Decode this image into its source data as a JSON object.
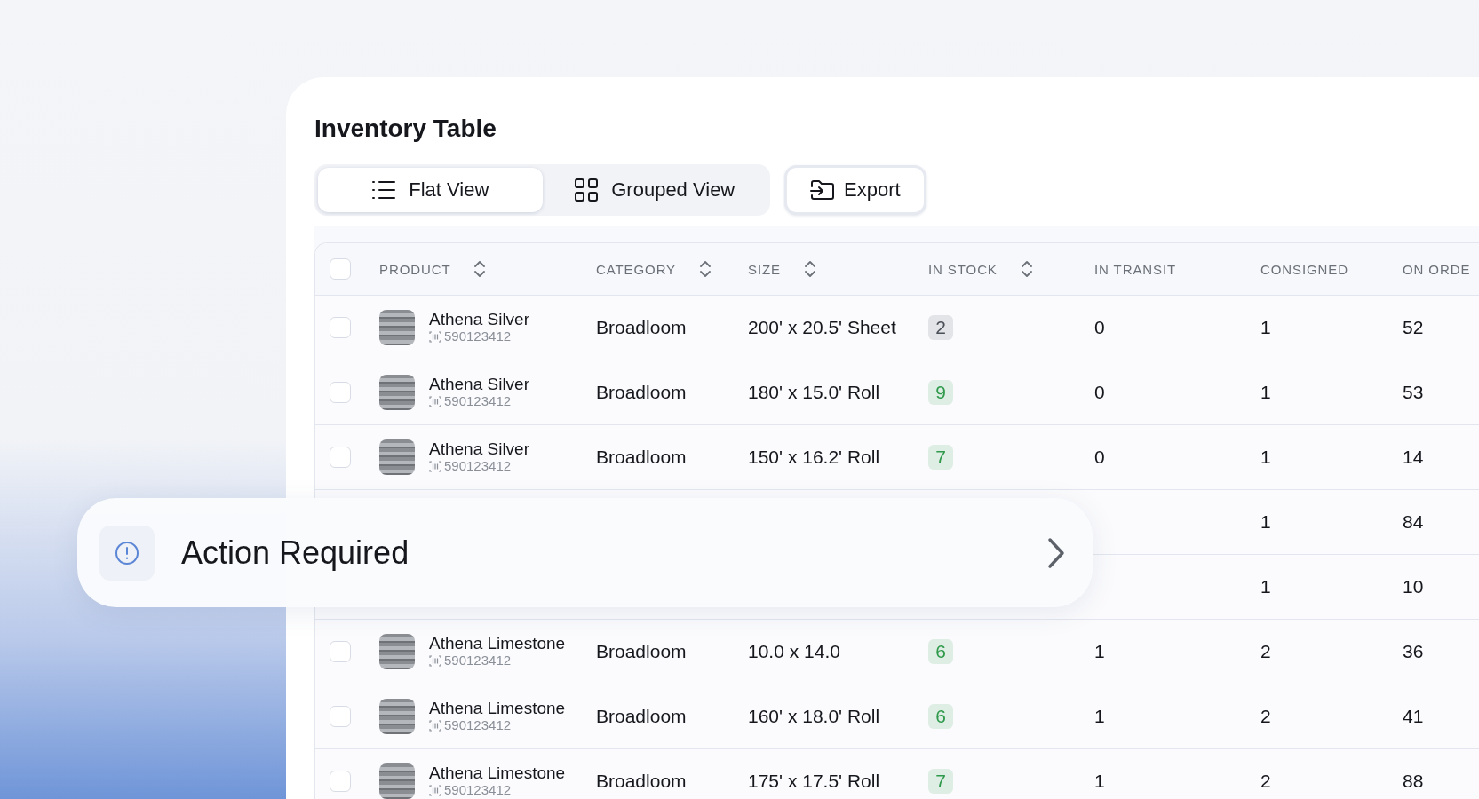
{
  "title": "Inventory Table",
  "view_tabs": [
    {
      "label": "Flat View",
      "selected": true
    },
    {
      "label": "Grouped View",
      "selected": false
    }
  ],
  "export_button": "Export",
  "table": {
    "select_all_checked": false,
    "columns": [
      {
        "label": "PRODUCT",
        "sortable": true
      },
      {
        "label": "CATEGORY",
        "sortable": true
      },
      {
        "label": "SIZE",
        "sortable": true
      },
      {
        "label": "IN STOCK",
        "sortable": true
      },
      {
        "label": "IN TRANSIT",
        "sortable": false
      },
      {
        "label": "CONSIGNED",
        "sortable": false
      },
      {
        "label": "ON ORDE",
        "sortable": false
      }
    ],
    "rows": [
      {
        "checked": false,
        "product": "Athena Silver",
        "sku": "590123412",
        "category": "Broadloom",
        "size": "200' x 20.5' Sheet",
        "in_stock": "2",
        "color": "#4b5058",
        "in_transit": "0",
        "consigned": "1",
        "on_order": "52"
      },
      {
        "checked": false,
        "product": "Athena Silver",
        "sku": "590123412",
        "category": "Broadloom",
        "size": "180' x 15.0' Roll",
        "in_stock": "9",
        "color": "#2f9a4b",
        "in_transit": "0",
        "consigned": "1",
        "on_order": "53"
      },
      {
        "checked": false,
        "product": "Athena Silver",
        "sku": "590123412",
        "category": "Broadloom",
        "size": "150' x 16.2' Roll",
        "in_stock": "7",
        "color": "#2f9a4b",
        "in_transit": "0",
        "consigned": "1",
        "on_order": "14"
      },
      {
        "consigned": "1",
        "on_order": "84"
      },
      {
        "consigned": "1",
        "on_order": "10"
      },
      {
        "checked": false,
        "product": "Athena Limestone",
        "sku": "590123412",
        "category": "Broadloom",
        "size": "10.0 x 14.0",
        "in_stock": "6",
        "color": "#2f9a4b",
        "in_transit": "1",
        "consigned": "2",
        "on_order": "36"
      },
      {
        "checked": false,
        "product": "Athena Limestone",
        "sku": "590123412",
        "category": "Broadloom",
        "size": "160' x 18.0' Roll",
        "in_stock": "6",
        "color": "#2f9a4b",
        "in_transit": "1",
        "consigned": "2",
        "on_order": "41"
      },
      {
        "checked": false,
        "product": "Athena Limestone",
        "sku": "590123412",
        "category": "Broadloom",
        "size": "175' x 17.5' Roll",
        "in_stock": "7",
        "color": "#2f9a4b",
        "in_transit": "1",
        "consigned": "2",
        "on_order": "88"
      }
    ]
  },
  "alert_banner": {
    "text": "Action Required"
  }
}
